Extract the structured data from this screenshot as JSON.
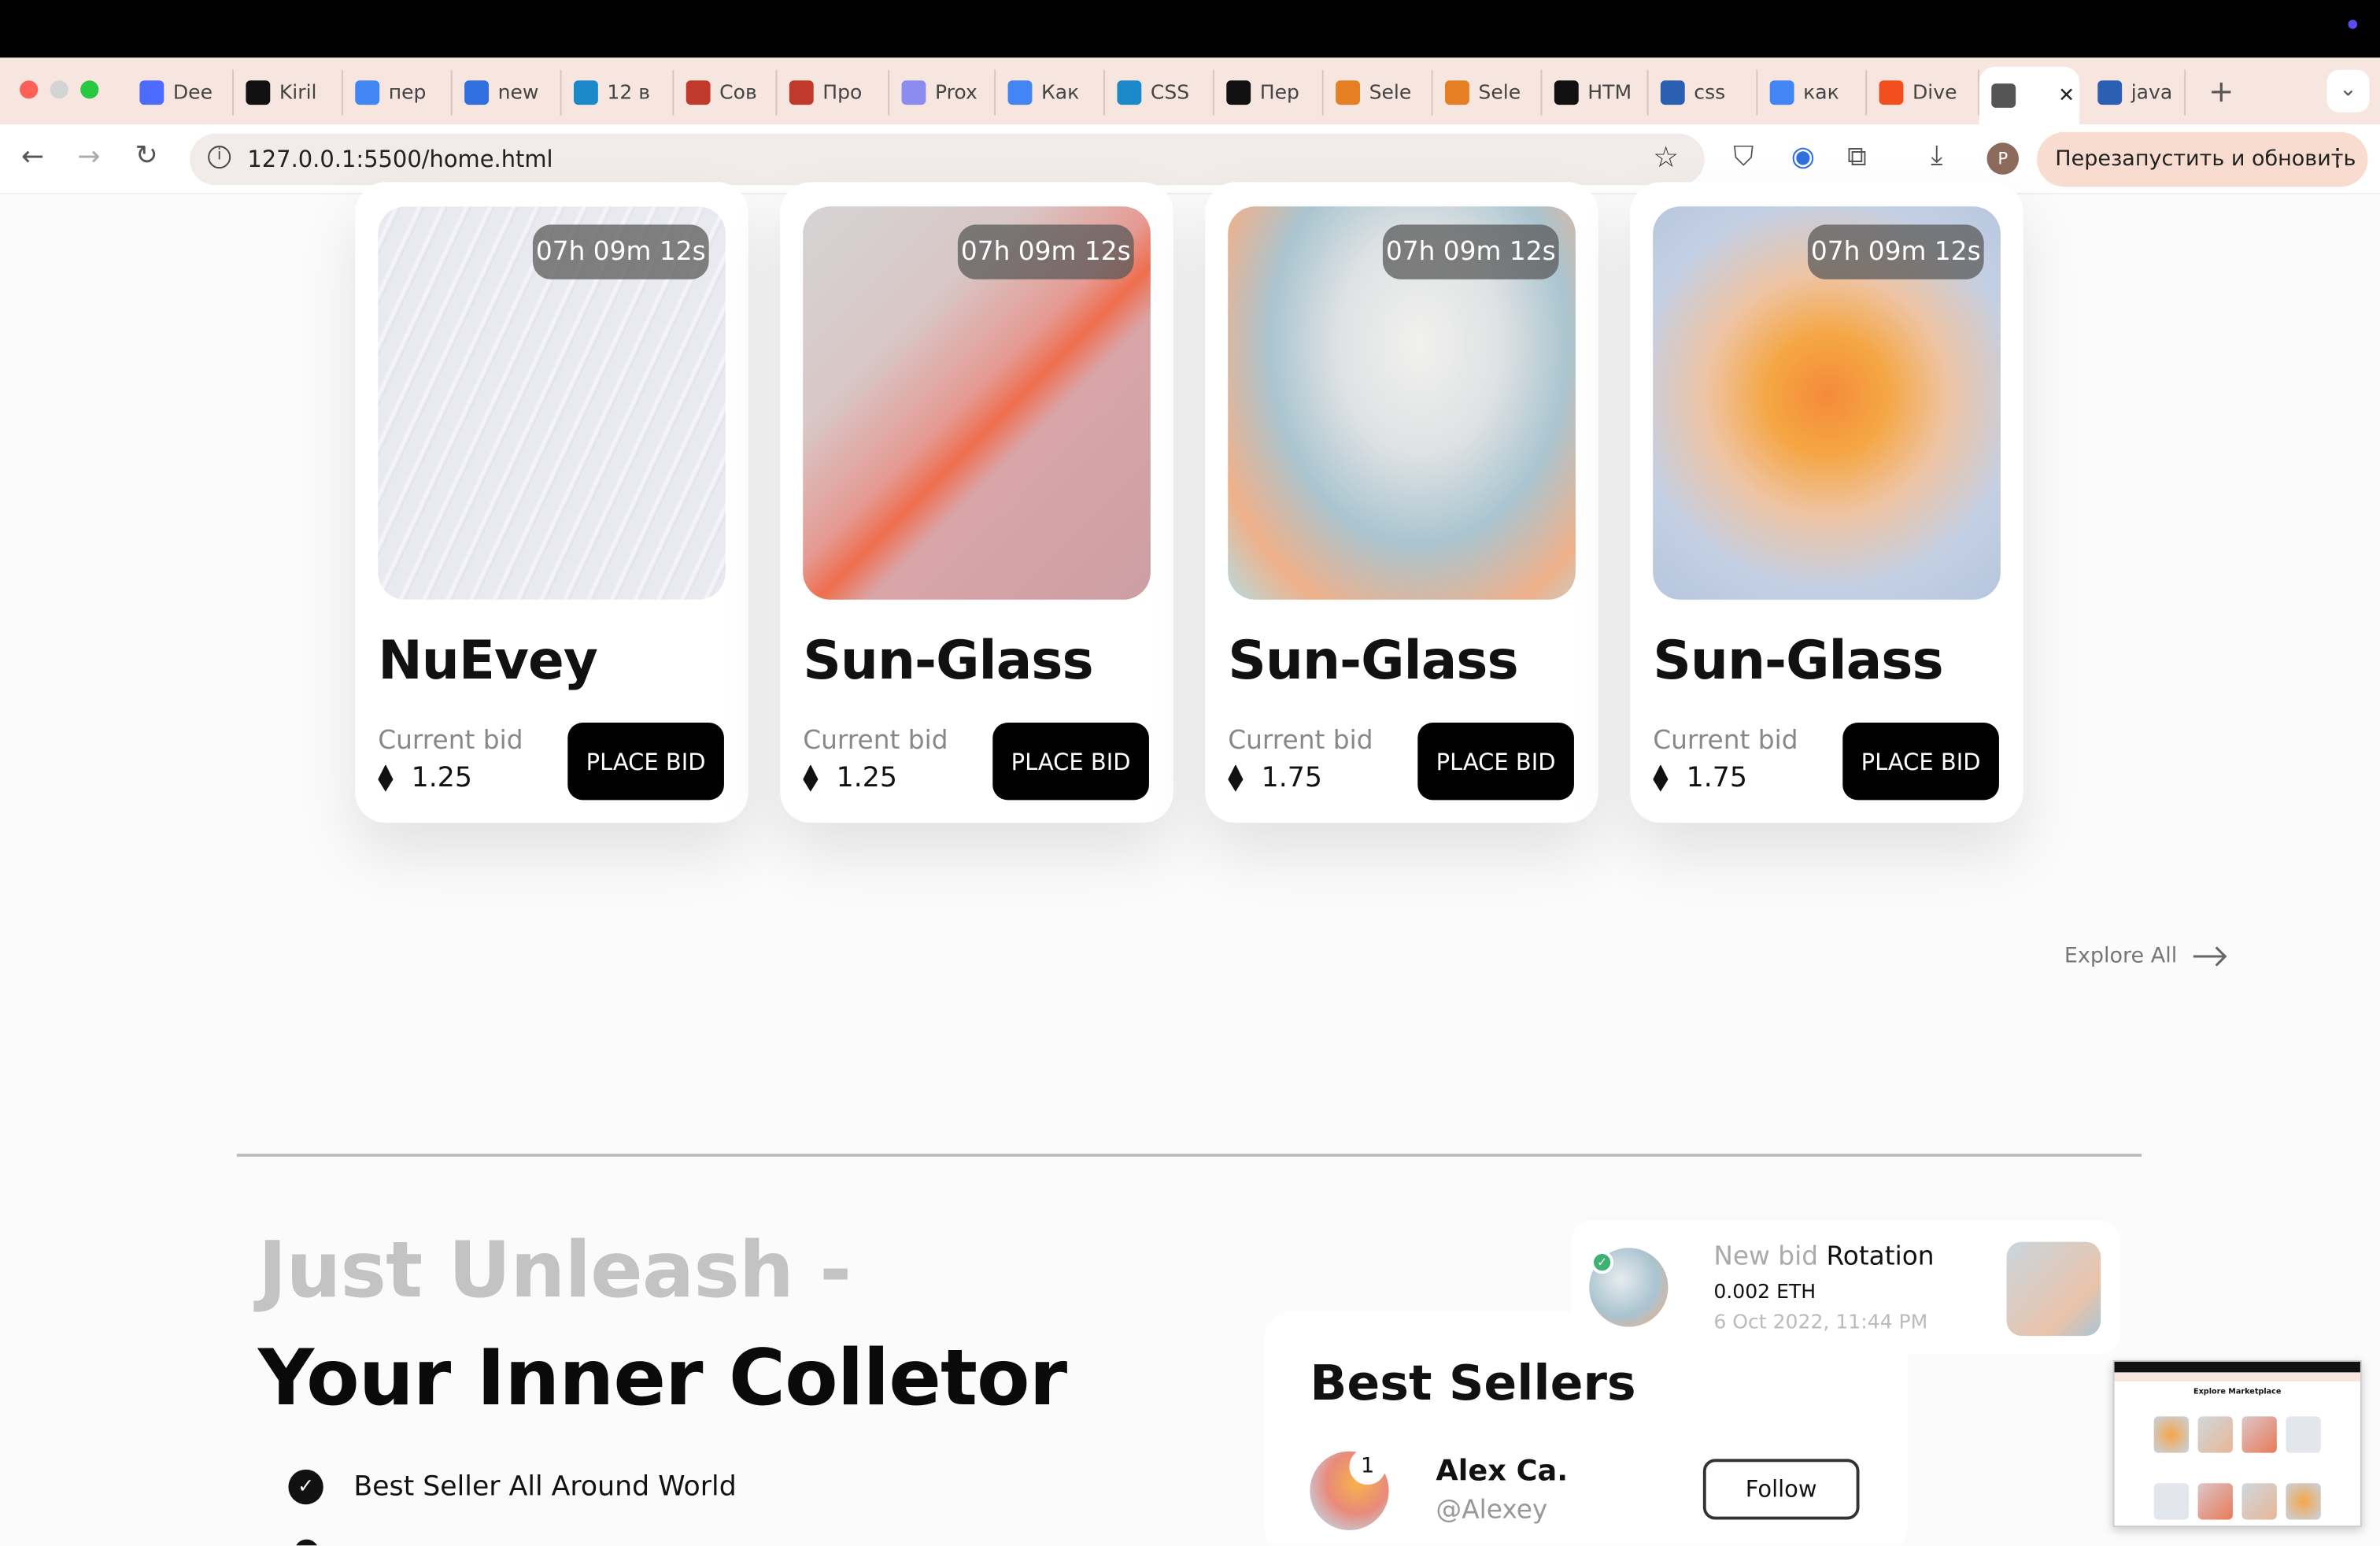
{
  "browser": {
    "tabs": [
      {
        "label": "Dee",
        "icon": "deepseek-icon",
        "color": "#4d6bfe"
      },
      {
        "label": "Kiril",
        "icon": "github-icon",
        "color": "#111111"
      },
      {
        "label": "пер",
        "icon": "google-icon",
        "color": "#4285f4"
      },
      {
        "label": "new",
        "icon": "circle-icon",
        "color": "#2f6fe0"
      },
      {
        "label": "12 в",
        "icon": "asterisk-icon",
        "color": "#1a88c9"
      },
      {
        "label": "Сов",
        "icon": "figure-icon",
        "color": "#c0392b"
      },
      {
        "label": "Про",
        "icon": "figure-icon",
        "color": "#c0392b"
      },
      {
        "label": "Prox",
        "icon": "globe-icon",
        "color": "#8c8cf0"
      },
      {
        "label": "Как",
        "icon": "google-icon",
        "color": "#4285f4"
      },
      {
        "label": "CSS",
        "icon": "asterisk-icon",
        "color": "#1a88c9"
      },
      {
        "label": "Пер",
        "icon": "m-icon",
        "color": "#111111"
      },
      {
        "label": "Sele",
        "icon": "blocks-icon",
        "color": "#e67e22"
      },
      {
        "label": "Sele",
        "icon": "blocks-icon",
        "color": "#e67e22"
      },
      {
        "label": "HTM",
        "icon": "m-icon",
        "color": "#111111"
      },
      {
        "label": "css",
        "icon": "stack-icon",
        "color": "#2b5fb4"
      },
      {
        "label": "как",
        "icon": "google-icon",
        "color": "#4285f4"
      },
      {
        "label": "Dive",
        "icon": "figma-icon",
        "color": "#f24e1e"
      },
      {
        "label": "",
        "icon": "globe-icon",
        "color": "#555555",
        "active": true
      },
      {
        "label": "java",
        "icon": "stack-icon",
        "color": "#2b5fb4"
      }
    ],
    "url": "127.0.0.1:5500/home.html",
    "relaunch_label": "Перезапустить и обновить",
    "profile_initial": "P"
  },
  "cards": [
    {
      "timer": "07h 09m 12s",
      "title": "NuEvey",
      "bid_label": "Current bid",
      "price": "1.25",
      "button": "PLACE BID",
      "art": "waves"
    },
    {
      "timer": "07h 09m 12s",
      "title": "Sun-Glass",
      "bid_label": "Current bid",
      "price": "1.25",
      "button": "PLACE BID",
      "art": "paint"
    },
    {
      "timer": "07h 09m 12s",
      "title": "Sun-Glass",
      "bid_label": "Current bid",
      "price": "1.75",
      "button": "PLACE BID",
      "art": "discs"
    },
    {
      "timer": "07h 09m 12s",
      "title": "Sun-Glass",
      "bid_label": "Current bid",
      "price": "1.75",
      "button": "PLACE BID",
      "art": "blur"
    }
  ],
  "explore_label": "Explore All",
  "hero": {
    "line1": "Just Unleash -",
    "line2": "Your Inner Colletor",
    "features": [
      "Best Seller All Around World"
    ]
  },
  "bid_notice": {
    "prefix": "New bid",
    "name": "Rotation",
    "amount": "0.002 ETH",
    "date": "6 Oct 2022, 11:44 PM"
  },
  "best_sellers": {
    "title": "Best Sellers",
    "items": [
      {
        "rank": "1",
        "name": "Alex Ca.",
        "handle": "@Alexey",
        "button": "Follow"
      }
    ]
  },
  "preview": {
    "title": "Explore Marketplace"
  }
}
